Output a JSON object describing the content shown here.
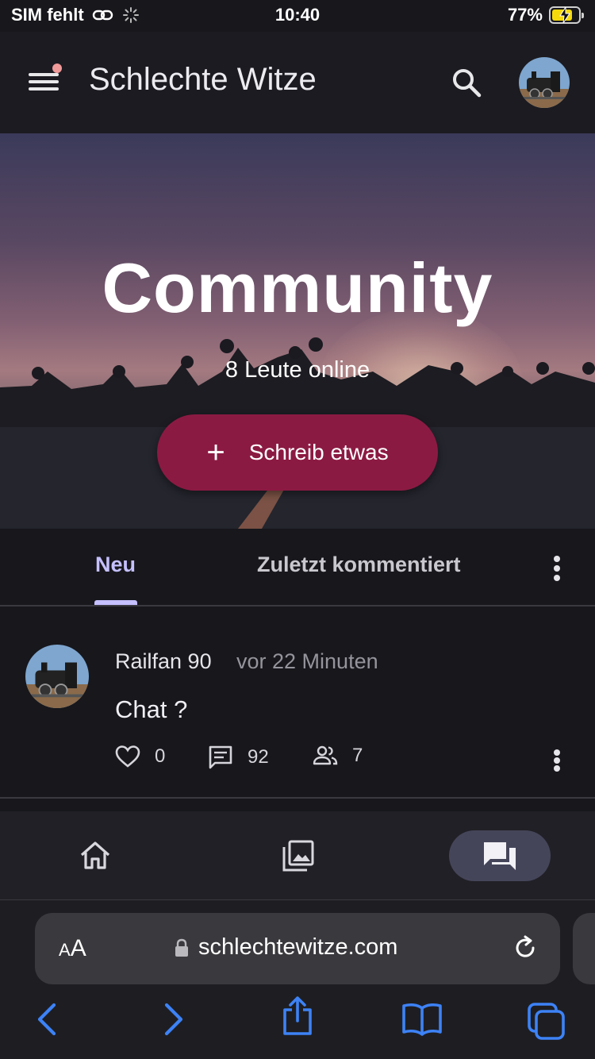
{
  "status_bar": {
    "carrier": "SIM fehlt",
    "time": "10:40",
    "battery_percent": "77%",
    "battery_level": 0.77,
    "link_icon": "link-icon",
    "loading_icon": "activity-spinner-icon",
    "charging_icon": "bolt-icon"
  },
  "app_bar": {
    "title": "Schlechte Witze",
    "menu_icon": "hamburger-menu-icon",
    "search_icon": "search-icon",
    "notification_dot_color": "#f19a9a"
  },
  "hero": {
    "title": "Community",
    "online_text": "8 Leute online",
    "write_button": {
      "icon": "plus-icon",
      "label": "Schreib etwas"
    },
    "button_color": "#8b1a42"
  },
  "tabs": {
    "items": [
      {
        "label": "Neu",
        "active": true
      },
      {
        "label": "Zuletzt kommentiert",
        "active": false
      }
    ],
    "more_icon": "more-vertical-icon",
    "active_color": "#c5c0ff"
  },
  "posts": [
    {
      "author": "Railfan 90",
      "time": "vor 22 Minuten",
      "text": "Chat ?",
      "likes": "0",
      "comments": "92",
      "participants": "7",
      "like_icon": "heart-outline-icon",
      "comment_icon": "comment-icon",
      "participants_icon": "people-icon"
    }
  ],
  "bottom_nav": {
    "items": [
      {
        "icon": "home-icon",
        "active": false
      },
      {
        "icon": "gallery-icon",
        "active": false
      },
      {
        "icon": "forum-icon",
        "active": true
      }
    ]
  },
  "browser": {
    "text_size_label_small": "A",
    "text_size_label_large": "A",
    "url": "schlechtewitze.com",
    "lock_icon": "lock-icon",
    "reload_icon": "reload-icon",
    "toolbar": [
      "back-icon",
      "forward-icon",
      "share-icon",
      "bookmarks-icon",
      "tabs-icon"
    ],
    "accent_color": "#3d82f6"
  }
}
